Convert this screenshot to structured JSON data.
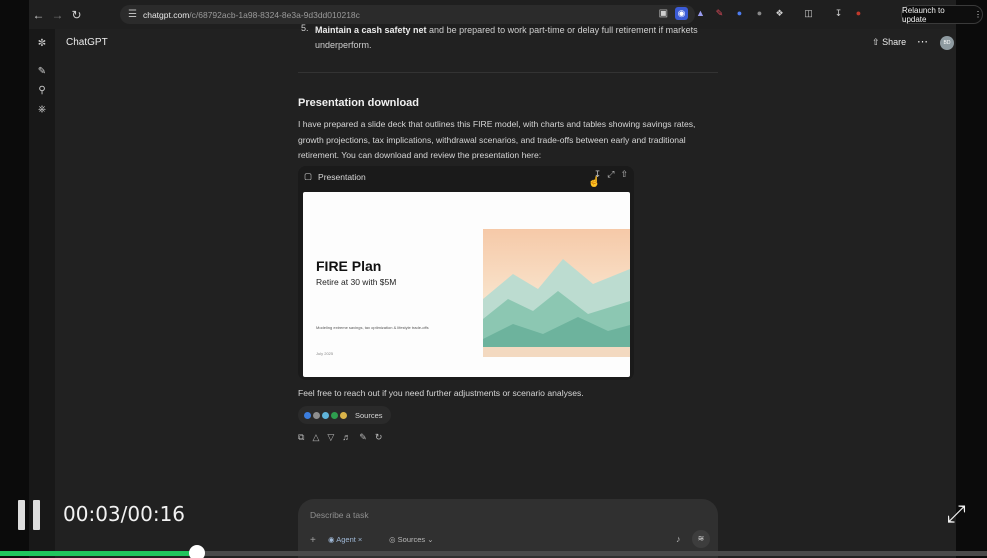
{
  "browser": {
    "url_host": "chatgpt.com",
    "url_path": "/c/68792acb-1a98-8324-8e3a-9d3dd010218c",
    "relaunch_label": "Relaunch to update"
  },
  "app": {
    "title": "ChatGPT",
    "share_label": "Share",
    "avatar_initials": "BD"
  },
  "conversation": {
    "list_item_number": "5.",
    "list_item_bold": "Maintain a cash safety net",
    "list_item_text": " and be prepared to work part-time or delay full retirement if markets underperform.",
    "section_heading": "Presentation download",
    "paragraph": "I have prepared a slide deck that outlines this FIRE model, with charts and tables showing savings rates, growth projections, tax implications, withdrawal scenarios, and trade-offs between early and traditional retirement. You can download and review the presentation here:",
    "presentation": {
      "label": "Presentation",
      "slide_title": "FIRE Plan",
      "slide_subtitle": "Retire at 30 with $5M",
      "slide_small": "Modeling extreme savings, tax optimization & lifestyle trade-offs",
      "slide_date": "July 2025"
    },
    "followup": "Feel free to reach out if you need further adjustments or scenario analyses.",
    "sources_label": "Sources"
  },
  "composer": {
    "placeholder": "Describe a task",
    "agent_label": "Agent",
    "sources_label": "Sources"
  },
  "video": {
    "time_display": "00:03/00:16",
    "progress": 0.2
  },
  "colors": {
    "progress": "#21c55d",
    "background": "#212121"
  }
}
